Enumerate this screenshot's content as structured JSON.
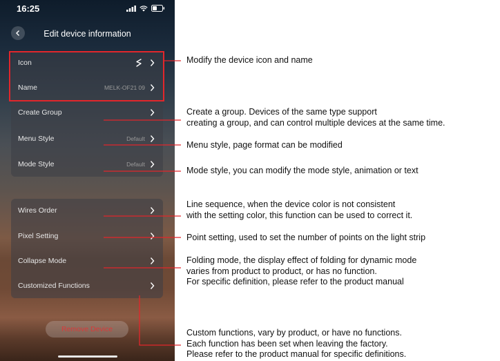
{
  "status": {
    "time": "16:25"
  },
  "nav": {
    "title": "Edit device information"
  },
  "group1": {
    "icon_label": "Icon",
    "name_label": "Name",
    "name_value": "MELK-OF21  09",
    "create_group_label": "Create Group",
    "menu_style_label": "Menu Style",
    "menu_style_value": "Default",
    "mode_style_label": "Mode Style",
    "mode_style_value": "Default"
  },
  "group2": {
    "wires_order_label": "Wires Order",
    "pixel_setting_label": "Pixel Setting",
    "collapse_mode_label": "Collapse Mode",
    "customized_functions_label": "Customized Functions"
  },
  "remove_button": {
    "label": "Remove Device"
  },
  "annotations": {
    "icon_name": [
      "Modify the device icon and name"
    ],
    "create_group": [
      "Create a group. Devices of the same type support",
      "creating a group, and can control multiple devices at the same time."
    ],
    "menu_style": [
      "Menu style, page format can be modified"
    ],
    "mode_style": [
      "Mode style, you can modify the mode style, animation or text"
    ],
    "wires_order": [
      "Line sequence, when the device color is not consistent",
      "with the setting color, this function can be used to correct it."
    ],
    "pixel_setting": [
      "Point setting, used to set the number of points on the light strip"
    ],
    "collapse_mode": [
      "Folding mode, the display effect of folding for dynamic mode",
      "varies from product to product, or has no function.",
      "For specific definition, please refer to the product manual"
    ],
    "customized_functions": [
      "Custom functions, vary by product, or have no functions.",
      "Each function has been set when leaving the factory.",
      "Please refer to the product manual for specific definitions."
    ]
  },
  "colors": {
    "callout_red": "#e3262b",
    "remove_text": "#d83a3a"
  }
}
